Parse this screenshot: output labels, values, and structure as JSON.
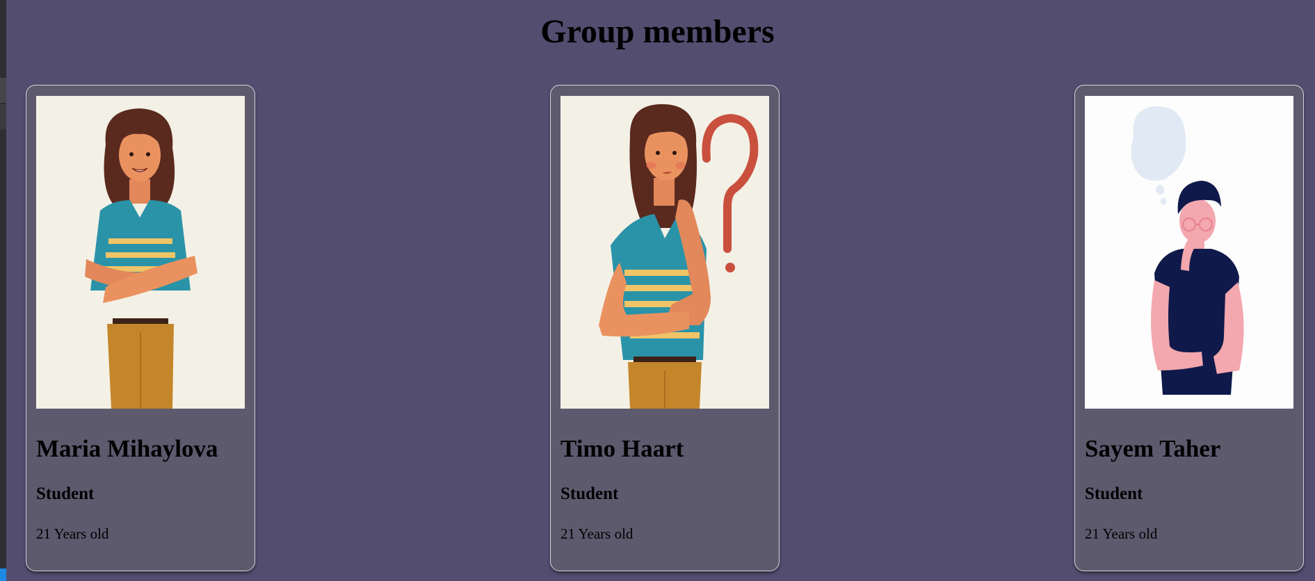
{
  "page": {
    "title": "Group members"
  },
  "members": [
    {
      "name": "Maria Mihaylova",
      "role": "Student",
      "age": "21 Years old",
      "image": "woman-arms-crossed-illustration"
    },
    {
      "name": "Timo Haart",
      "role": "Student",
      "age": "21 Years old",
      "image": "woman-thinking-question-mark-illustration"
    },
    {
      "name": "Sayem Taher",
      "role": "Student",
      "age": "21 Years old",
      "image": "man-thinking-thought-bubble-illustration"
    }
  ],
  "colors": {
    "background": "#534d70",
    "card": "#5d5a6e",
    "card_border": "#d8d6e0"
  }
}
